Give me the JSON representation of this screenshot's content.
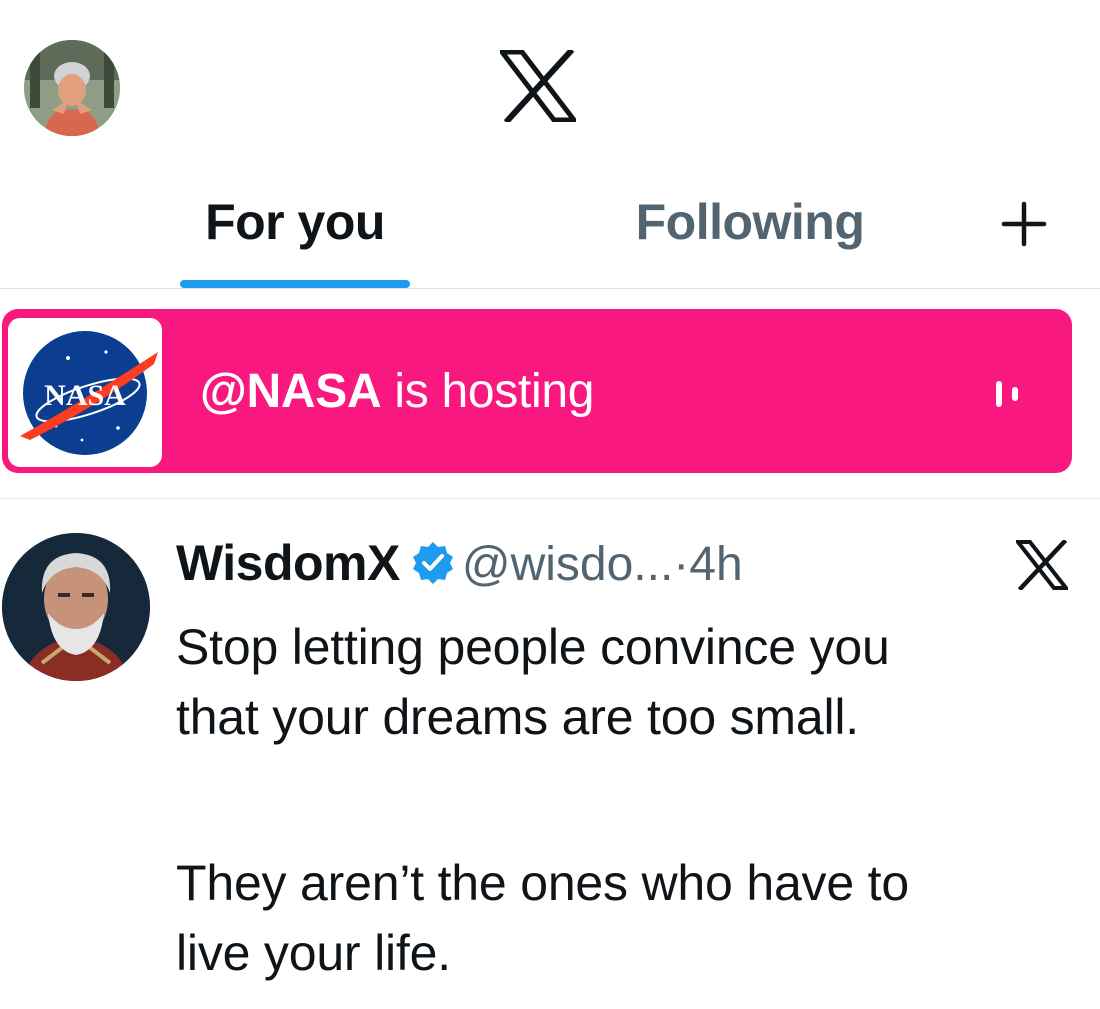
{
  "header": {
    "user_avatar": "user-avatar-photo",
    "logo_icon": "x-logo-icon"
  },
  "tabs": [
    {
      "label": "For you",
      "active": true
    },
    {
      "label": "Following",
      "active": false
    }
  ],
  "add_tab_icon": "plus-icon",
  "space_banner": {
    "host_handle": "@NASA",
    "status_text": " is hosting",
    "logo_text": "NASA",
    "background_color": "#f91880",
    "audio_icon": "audio-bars-icon"
  },
  "post": {
    "author_name": "WisdomX",
    "verified": true,
    "handle": "@wisdo...",
    "separator": "·",
    "time": "4h",
    "more_icon": "x-icon",
    "text_lines": [
      "Stop letting people convince you",
      "that your dreams are too small.",
      "They aren’t the ones who have to",
      "live your life."
    ]
  },
  "colors": {
    "accent": "#1d9bf0",
    "text_primary": "#0f1419",
    "text_secondary": "#536471"
  }
}
